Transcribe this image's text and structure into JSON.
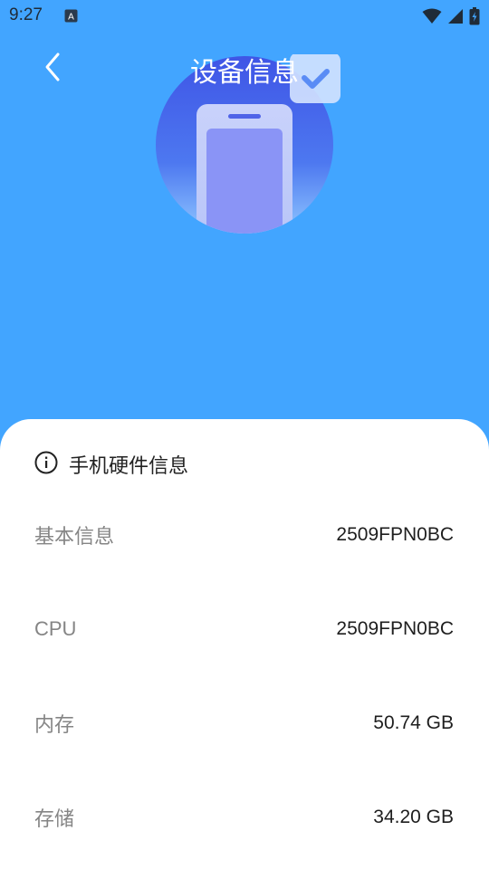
{
  "status_bar": {
    "time": "9:27",
    "icons": [
      "app-notification-icon",
      "wifi-icon",
      "cell-signal-icon",
      "battery-charging-icon"
    ]
  },
  "header": {
    "title": "设备信息",
    "back_icon": "chevron-left-icon"
  },
  "card": {
    "title": "手机硬件信息",
    "title_icon": "info-icon",
    "rows": [
      {
        "label": "基本信息",
        "value": "2509FPN0BC"
      },
      {
        "label": "CPU",
        "value": "2509FPN0BC"
      },
      {
        "label": "内存",
        "value": "50.74 GB"
      },
      {
        "label": "存储",
        "value": "34.20 GB"
      }
    ]
  },
  "colors": {
    "background": "#42a5ff",
    "card": "#ffffff",
    "label": "#858585",
    "value": "#1e1e1e"
  }
}
